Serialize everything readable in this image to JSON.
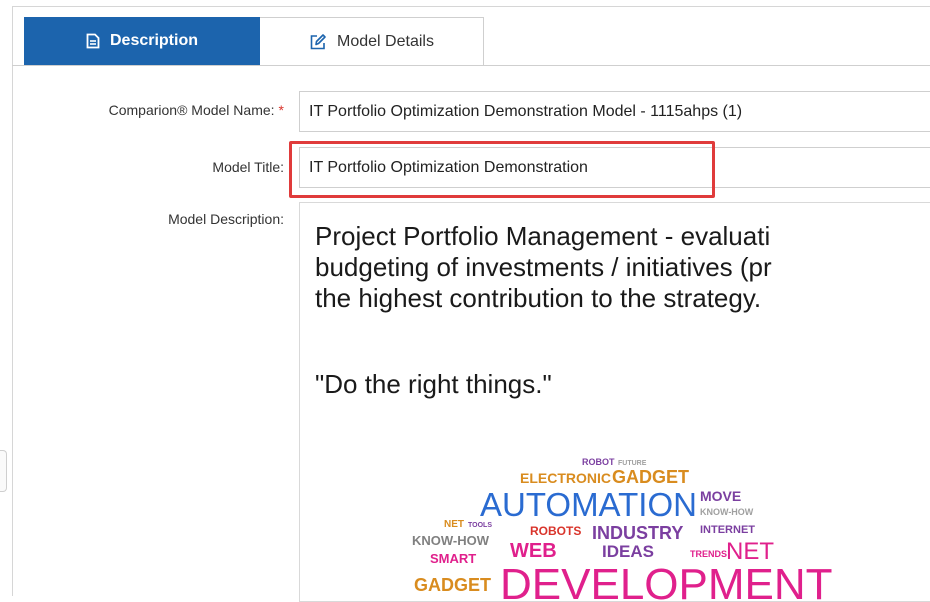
{
  "tabs": [
    {
      "label": "Description",
      "icon": "document-icon",
      "active": true
    },
    {
      "label": "Model Details",
      "icon": "edit-icon",
      "active": false
    }
  ],
  "form": {
    "model_name": {
      "label": "Comparion® Model Name:",
      "required_mark": "*",
      "value": "IT Portfolio Optimization Demonstration Model - 1115ahps (1)"
    },
    "model_title": {
      "label": "Model Title:",
      "value": "IT Portfolio Optimization Demonstration"
    },
    "model_description": {
      "label": "Model Description:",
      "lines": [
        "Project Portfolio Management - evaluati",
        "budgeting of investments / initiatives (pr",
        "the highest contribution to the strategy."
      ],
      "quote": "\"Do the right things.\""
    }
  },
  "word_cloud": {
    "words": [
      {
        "text": "ROBOT",
        "color": "#7b3fa0"
      },
      {
        "text": "FUTURE",
        "color": "#a0a0a0"
      },
      {
        "text": "ELECTRONIC",
        "color": "#d98c1f"
      },
      {
        "text": "GADGET",
        "color": "#d98c1f"
      },
      {
        "text": "AUTOMATION",
        "color": "#2a6bd1"
      },
      {
        "text": "MOVE",
        "color": "#7b3fa0"
      },
      {
        "text": "KNOW-HOW",
        "color": "#a0a0a0"
      },
      {
        "text": "NET",
        "color": "#d98c1f"
      },
      {
        "text": "TOOLS",
        "color": "#7b3fa0"
      },
      {
        "text": "ROBOTS",
        "color": "#d9342b"
      },
      {
        "text": "INDUSTRY",
        "color": "#7b3fa0"
      },
      {
        "text": "INTERNET",
        "color": "#7b3fa0"
      },
      {
        "text": "KNOW-HOW",
        "color": "#808080"
      },
      {
        "text": "WEB",
        "color": "#e0208c"
      },
      {
        "text": "IDEAS",
        "color": "#7b3fa0"
      },
      {
        "text": "TRENDS",
        "color": "#e0208c"
      },
      {
        "text": "NET",
        "color": "#e0208c"
      },
      {
        "text": "SMART",
        "color": "#e0208c"
      },
      {
        "text": "GADGET",
        "color": "#d98c1f"
      },
      {
        "text": "DEVELOPMENT",
        "color": "#e0208c"
      }
    ]
  },
  "colors": {
    "accent": "#1c64ad",
    "highlight": "#e03b3b",
    "required": "#d9342b"
  }
}
